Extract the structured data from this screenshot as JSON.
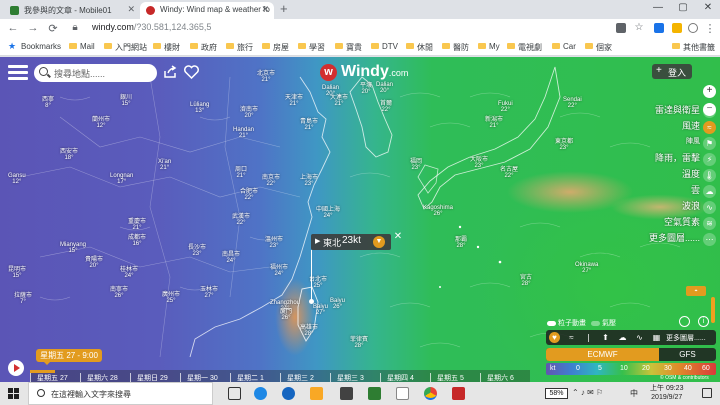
{
  "browser": {
    "tabs": [
      {
        "title": "我參與的文章 - Mobile01",
        "favicon_color": "#2e7d32",
        "active": false
      },
      {
        "title": "Windy: Wind map & weather fo",
        "favicon_color": "#c62828",
        "active": true
      }
    ],
    "new_tab": "+",
    "window_controls": {
      "minimize": "—",
      "maximize": "▢",
      "close": "✕"
    },
    "nav": {
      "back": "←",
      "forward": "→",
      "reload": "⟳"
    },
    "url": {
      "host": "windy.com",
      "path": "/?30.581,124.365,5"
    },
    "bookmarks": [
      "Bookmarks",
      "Mail",
      "入門網站",
      "樓財",
      "政府",
      "旅行",
      "房屋",
      "學習",
      "寶貴",
      "DTV",
      "休閒",
      "醫防",
      "My",
      "電視劇",
      "Car",
      "個家",
      "其他書籤"
    ]
  },
  "windy": {
    "search_placeholder": "搜尋地點......",
    "logo_word": "Windy",
    "logo_domain": ".com",
    "login_label": "登入",
    "layers": [
      {
        "label": "雷達與衛星",
        "icon": "radar-icon",
        "active": false
      },
      {
        "label": "風速",
        "icon": "wind-icon",
        "active": true
      },
      {
        "label": "陣風",
        "icon": "gust-icon",
        "active": false,
        "small": true
      },
      {
        "label": "降雨，雷擊",
        "icon": "rain-icon",
        "active": false
      },
      {
        "label": "溫度",
        "icon": "thermometer-icon",
        "active": false
      },
      {
        "label": "雲",
        "icon": "cloud-icon",
        "active": false
      },
      {
        "label": "波浪",
        "icon": "wave-icon",
        "active": false
      },
      {
        "label": "空氣質素",
        "icon": "air-quality-icon",
        "active": false
      },
      {
        "label": "更多圖層......",
        "icon": "more-icon",
        "active": false
      }
    ],
    "popup": {
      "direction": "東北",
      "speed": "23kt"
    },
    "particles_label": "粒子動畫",
    "pressure_label": "氣壓",
    "more_layers_label": "更多圖層......",
    "models": {
      "active": "ECMWF",
      "other": "GFS"
    },
    "legend": {
      "unit": "kt",
      "ticks": [
        "0",
        "5",
        "10",
        "20",
        "30",
        "40",
        "60"
      ]
    },
    "time_bubble": "星期五 27 - 9:00",
    "timeline_days": [
      "星期五 27",
      "星期六 28",
      "星期日 29",
      "星期一 30",
      "星期二 1",
      "星期三 2",
      "星期三 3",
      "星期四 4",
      "星期五 5",
      "星期六 6"
    ],
    "timeline_progress": 0.05,
    "cities": [
      {
        "name": "北京市",
        "temp": "21°"
      },
      {
        "name": "天津市",
        "temp": "21°"
      },
      {
        "name": "大連市",
        "temp": "21°"
      },
      {
        "name": "Dalian",
        "temp": "20°"
      },
      {
        "name": "平壤",
        "temp": "20°"
      },
      {
        "name": "首爾",
        "temp": "22°"
      },
      {
        "name": "濟南市",
        "temp": "20°"
      },
      {
        "name": "青島市",
        "temp": "21°"
      },
      {
        "name": "Handan",
        "temp": "21°"
      },
      {
        "name": "Lüliang",
        "temp": "13°"
      },
      {
        "name": "銀川",
        "temp": "15°"
      },
      {
        "name": "蘭州市",
        "temp": "12°"
      },
      {
        "name": "西寧",
        "temp": "8°"
      },
      {
        "name": "Xi'an",
        "temp": "21°"
      },
      {
        "name": "Longnan",
        "temp": "17°"
      },
      {
        "name": "Gansu",
        "temp": "12°"
      },
      {
        "name": "西安市",
        "temp": "18°"
      },
      {
        "name": "周口",
        "temp": "21°"
      },
      {
        "name": "南京市",
        "temp": "22°"
      },
      {
        "name": "合肥市",
        "temp": "22°"
      },
      {
        "name": "上海市",
        "temp": "23°"
      },
      {
        "name": "中國上海",
        "temp": "24°"
      },
      {
        "name": "成都市",
        "temp": "16°"
      },
      {
        "name": "重慶市",
        "temp": "21°"
      },
      {
        "name": "武漢市",
        "temp": "22°"
      },
      {
        "name": "溫州市",
        "temp": "23°"
      },
      {
        "name": "長沙市",
        "temp": "23°"
      },
      {
        "name": "南昌市",
        "temp": "24°"
      },
      {
        "name": "福州市",
        "temp": "24°"
      },
      {
        "name": "Zhangzhou",
        "temp": "24°"
      },
      {
        "name": "台北市",
        "temp": "25°"
      },
      {
        "name": "昆明市",
        "temp": "15°"
      },
      {
        "name": "貴陽市",
        "temp": "20°"
      },
      {
        "name": "桂林市",
        "temp": "24°"
      },
      {
        "name": "廣州市",
        "temp": "25°"
      },
      {
        "name": "玉林市",
        "temp": "27°"
      },
      {
        "name": "南寧市",
        "temp": "26°"
      },
      {
        "name": "Baiyu",
        "temp": "26°"
      },
      {
        "name": "Sendai",
        "temp": "22°"
      },
      {
        "name": "東京都",
        "temp": "23°"
      },
      {
        "name": "新潟市",
        "temp": "21°"
      },
      {
        "name": "大阪市",
        "temp": "23°"
      },
      {
        "name": "名古屋",
        "temp": "22°"
      },
      {
        "name": "福岡",
        "temp": "23°"
      },
      {
        "name": "Kagoshima",
        "temp": "26°"
      },
      {
        "name": "Okinawa",
        "temp": "27°"
      },
      {
        "name": "拉薩市",
        "temp": "7°"
      },
      {
        "name": "Mianyang",
        "temp": "15°"
      },
      {
        "name": "Dalian",
        "temp": "20°"
      },
      {
        "name": "Fukui",
        "temp": "22°"
      },
      {
        "name": "那霸",
        "temp": "28°"
      },
      {
        "name": "宮古",
        "temp": "28°"
      },
      {
        "name": "菲律賓",
        "temp": "28°"
      },
      {
        "name": "廈門",
        "temp": "26°"
      },
      {
        "name": "高雄市",
        "temp": "28°"
      },
      {
        "name": "Baiyu",
        "temp": "27°"
      }
    ],
    "attribution": "© OSM & contributors"
  },
  "taskbar": {
    "search_placeholder": "在這裡輸入文字來搜尋",
    "battery": "58%",
    "ime": "中",
    "time": "上午 09:23",
    "date": "2019/9/27"
  }
}
